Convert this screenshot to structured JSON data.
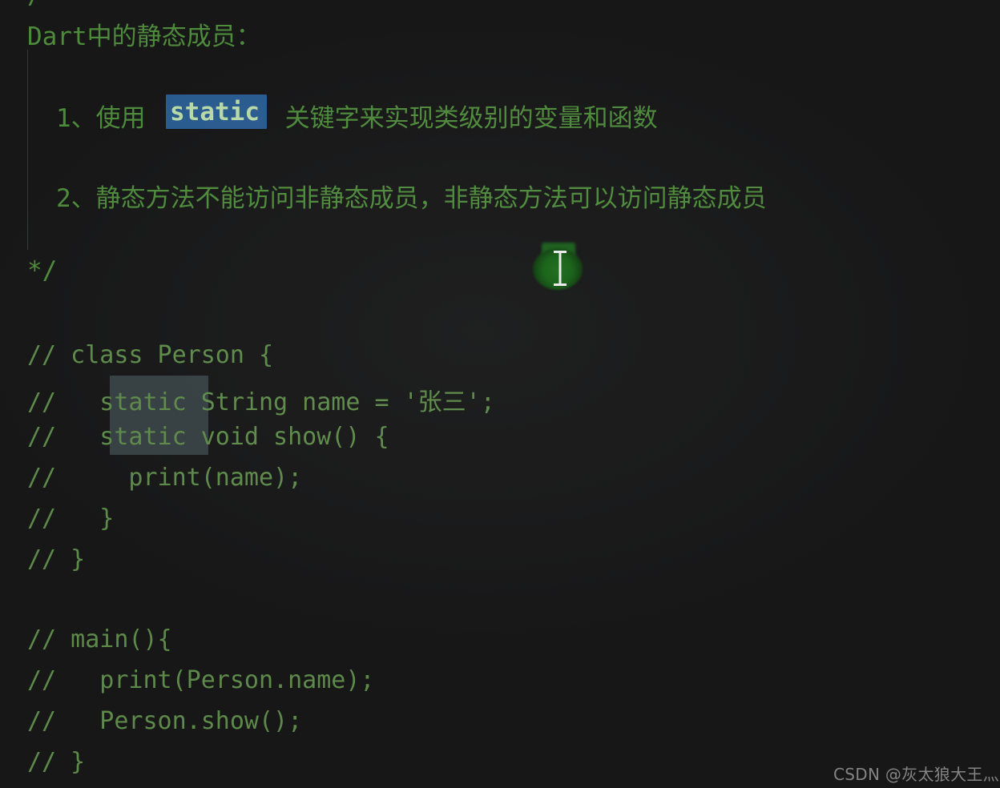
{
  "editor": {
    "background_color": "#171718",
    "comment_color": "#5d8a4a",
    "doc_color": "#4e8a3c",
    "selection_color": "#2a5b8f",
    "match_highlight_color": "#3a4347",
    "top_partial_glyph": "/"
  },
  "block_comment": {
    "heading": "Dart中的静态成员：",
    "item_1": {
      "prefix": "1、使用",
      "keyword": "static",
      "suffix": " 关键字来实现类级别的变量和函数"
    },
    "item_2": "2、静态方法不能访问非静态成员，非静态方法可以访问静态成员",
    "close": "*/"
  },
  "code_lines": [
    {
      "id": "class-open",
      "text": "// class Person {"
    },
    {
      "id": "static-name",
      "text": "//   static String name = '张三';"
    },
    {
      "id": "static-show",
      "text": "//   static void show() {"
    },
    {
      "id": "print-name",
      "text": "//     print(name);"
    },
    {
      "id": "show-close",
      "text": "//   }"
    },
    {
      "id": "class-close",
      "text": "// }"
    },
    {
      "id": "main-open",
      "text": "// main(){"
    },
    {
      "id": "print-person",
      "text": "//   print(Person.name);"
    },
    {
      "id": "person-show",
      "text": "//   Person.show();"
    },
    {
      "id": "main-close",
      "text": "// }"
    }
  ],
  "cursor": {
    "icon": "text-ibeam-cursor",
    "glow_color": "#176117",
    "ibeam_color": "#e8e8e8"
  },
  "watermark": {
    "text": "CSDN @灰太狼大王灬"
  }
}
